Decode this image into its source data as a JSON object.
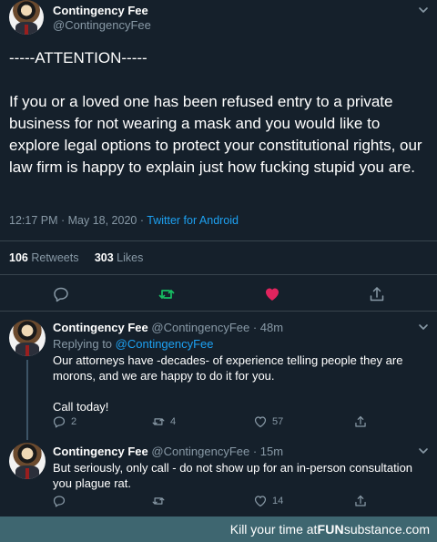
{
  "main_tweet": {
    "display_name": "Contingency Fee",
    "handle": "@ContingencyFee",
    "heading": "-----ATTENTION-----",
    "body": "If you or a loved one has been refused entry to a private business for not wearing a mask and you would like to explore legal options to protect your constitutional rights, our law firm is happy to explain just how fucking stupid you are.",
    "timestamp": "12:17 PM · May 18, 2020 · ",
    "source": "Twitter for Android",
    "retweets_count": "106",
    "retweets_label": "Retweets",
    "likes_count": "303",
    "likes_label": "Likes"
  },
  "replies": [
    {
      "display_name": "Contingency Fee",
      "handle": "@ContingencyFee · 48m",
      "replying_prefix": "Replying to ",
      "replying_to": "@ContingencyFee",
      "text_1": "Our attorneys have -decades- of experience telling people they are morons, and we are happy to do it for you.",
      "text_2": "Call today!",
      "reply_count": "2",
      "retweet_count": "4",
      "like_count": "57"
    },
    {
      "display_name": "Contingency Fee",
      "handle": "@ContingencyFee · 15m",
      "text_1": "But seriously, only call - do not show up for an in-person consultation you plague rat.",
      "reply_count": "",
      "retweet_count": "",
      "like_count": "14"
    }
  ],
  "footer": {
    "prefix": "Kill your time at ",
    "brand_fun": "FUN",
    "brand_rest": "substance",
    "suffix": ".com"
  },
  "colors": {
    "background": "#15202b",
    "secondary_text": "#8899a6",
    "link": "#1da1f2",
    "retweet_active": "#17bf63",
    "like_active": "#e0245e",
    "footer_bg": "#3e6670"
  },
  "icons": [
    "chevron-down-icon",
    "reply-icon",
    "retweet-icon",
    "like-icon",
    "share-icon"
  ]
}
